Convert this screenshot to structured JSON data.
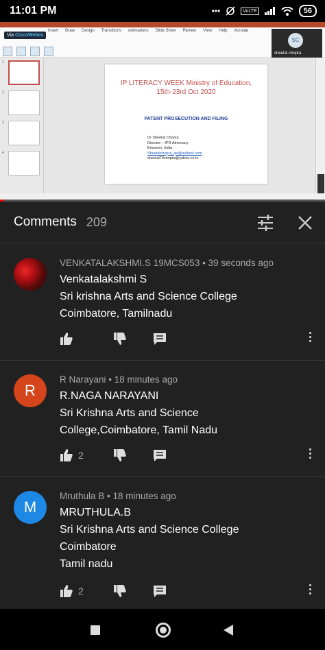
{
  "status_bar": {
    "time": "11:01 PM",
    "volte": "VoLTE",
    "battery": "56"
  },
  "video": {
    "webex_prefix": "Via",
    "webex_brand": "CiscoWebex",
    "presenter_initials": "SC",
    "presenter_name": "sheetal chopra",
    "ribbon_tabs": [
      "Insert",
      "Draw",
      "Design",
      "Transitions",
      "Animations",
      "Slide Show",
      "Review",
      "View",
      "Help",
      "Acrobat"
    ],
    "slide": {
      "title_line1": "IP LITERACY WEEK Ministry of Education,",
      "title_line2": "15th-23rd Oct 2020",
      "subtitle": "PATENT PROSECUTION AND FILING",
      "author_lines": [
        "Dr Sheetal Chopra",
        "Director – IPR Advocacy",
        "Ericsson, India"
      ],
      "author_email1": "Sheetalchopra_ipr@outlook.com",
      "author_email2": "sheetal79chopra@yahoo.co.in"
    },
    "thumb_numbers": [
      "1",
      "2",
      "3",
      "4"
    ],
    "progress_fraction": 0.01
  },
  "comments_panel": {
    "title": "Comments",
    "count": "209",
    "comments": [
      {
        "meta": "VENKATALAKSHMI.S 19MCS053 • 39 seconds ago",
        "name": "Venkatalakshmi S",
        "lines": [
          "Sri krishna Arts and Science College",
          "Coimbatore, Tamilnadu"
        ],
        "likes": ""
      },
      {
        "avatar_letter": "R",
        "avatar_color": "#d5451b",
        "meta": "R Narayani • 18 minutes ago",
        "name": "R.NAGA NARAYANI",
        "lines": [
          "Sri Krishna Arts and Science",
          "College,Coimbatore, Tamil Nadu"
        ],
        "likes": "2"
      },
      {
        "avatar_letter": "M",
        "avatar_color": "#1e88e5",
        "meta": "Mruthula B • 18 minutes ago",
        "name": "MRUTHULA.B",
        "lines": [
          "Sri Krishna Arts and Science College",
          "Coimbatore",
          "Tamil nadu"
        ],
        "likes": "2"
      }
    ]
  }
}
